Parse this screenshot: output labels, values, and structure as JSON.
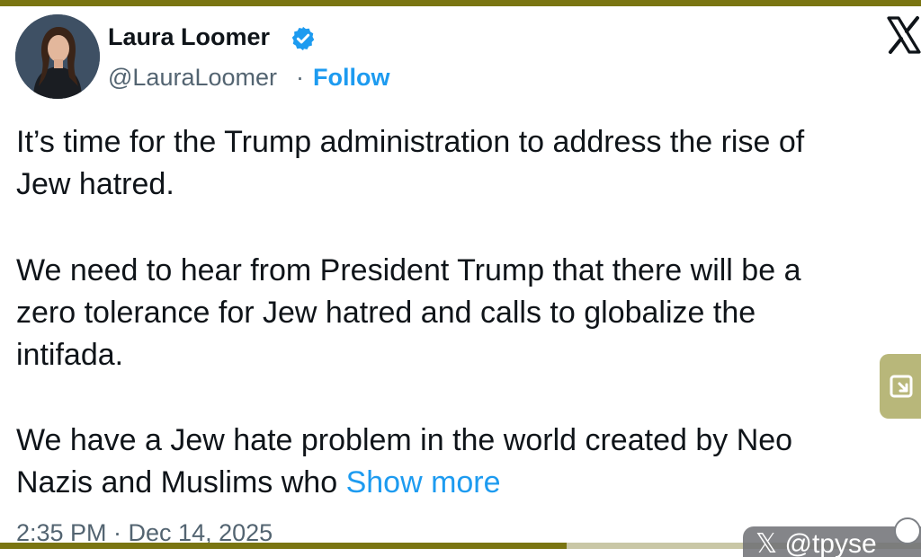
{
  "tweet": {
    "author": {
      "name": "Laura Loomer",
      "handle": "@LauraLoomer",
      "separator": "·",
      "follow_label": "Follow",
      "verified": true,
      "verified_color": "#1d9bf0"
    },
    "paragraphs": [
      [
        "It’s time for the Trump administration to address the rise of",
        "Jew hatred."
      ],
      [
        "We need to hear from President Trump that there will be a",
        "zero tolerance for Jew hatred and calls to globalize the",
        "intifada."
      ],
      [
        "We have a Jew hate problem in the world created by Neo",
        "Nazis and Muslims who"
      ]
    ],
    "show_more_label": "Show more",
    "timestamp": "2:35 PM · Dec 14, 2025"
  },
  "video_overlay": {
    "progress": 0.615,
    "accent_color": "#7a7512",
    "watermark_text": "𝕏 @tpyse"
  },
  "icons": {
    "platform_logo": "x-logo-icon",
    "side_tab": "exit-fullscreen-icon"
  }
}
